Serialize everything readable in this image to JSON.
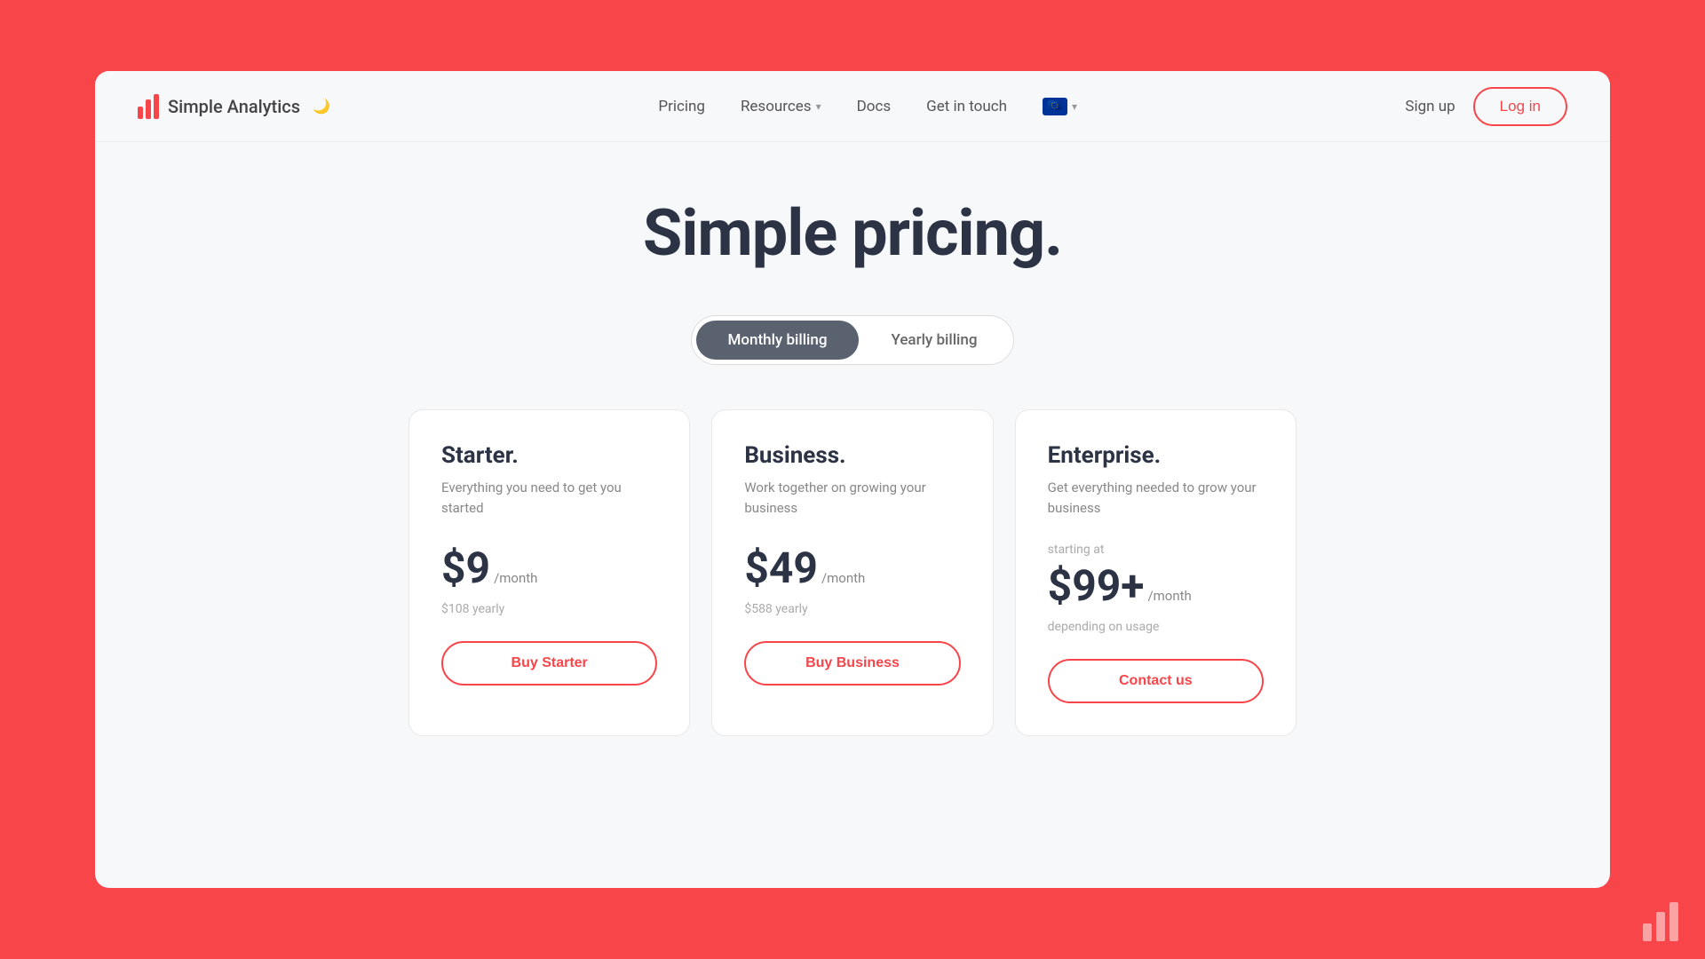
{
  "background_color": "#f7454a",
  "logo": {
    "text": "Simple Analytics",
    "moon": "🌙"
  },
  "nav": {
    "links": [
      {
        "label": "Pricing",
        "has_dropdown": false
      },
      {
        "label": "Resources",
        "has_dropdown": true
      },
      {
        "label": "Docs",
        "has_dropdown": false
      },
      {
        "label": "Get in touch",
        "has_dropdown": false
      }
    ],
    "eu_label": "🇪🇺",
    "sign_up": "Sign up",
    "log_in": "Log in"
  },
  "hero": {
    "title": "Simple pricing."
  },
  "billing_toggle": {
    "monthly": "Monthly billing",
    "yearly": "Yearly billing"
  },
  "plans": [
    {
      "name": "Starter.",
      "description": "Everything you need to get you started",
      "starting_at": "",
      "price": "$9",
      "period": "/month",
      "yearly": "$108 yearly",
      "depending": "",
      "button": "Buy Starter"
    },
    {
      "name": "Business.",
      "description": "Work together on growing your business",
      "starting_at": "",
      "price": "$49",
      "period": "/month",
      "yearly": "$588 yearly",
      "depending": "",
      "button": "Buy Business"
    },
    {
      "name": "Enterprise.",
      "description": "Get everything needed to grow your business",
      "starting_at": "starting at",
      "price": "$99+",
      "period": "/month",
      "yearly": "",
      "depending": "depending on usage",
      "button": "Contact us"
    }
  ]
}
